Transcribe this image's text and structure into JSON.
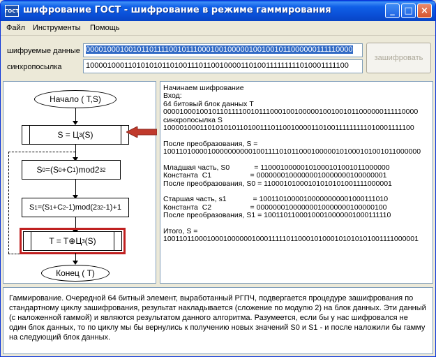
{
  "window": {
    "icon_label": "ГОСТ",
    "title": "шифрование ГОСТ - шифрование в режиме гаммирования",
    "minimize_glyph": "_",
    "maximize_glyph": "□",
    "close_glyph": "×"
  },
  "menu": {
    "items": [
      "Файл",
      "Инструменты",
      "Помощь"
    ]
  },
  "form": {
    "data_label": "шифруемые данные",
    "data_value": "0000100010010110111100101110001001000001001001011000000111110000",
    "sync_label": "синхропосылка",
    "sync_value": "1000010001101010101101001110110010000110100111111111010001111100",
    "encrypt_button": "зашифровать"
  },
  "flowchart": {
    "start": "Начало ( T,S)",
    "step1": {
      "lhs": "S = ",
      "func": "Ц",
      "sub": "3",
      "arg": "(S)"
    },
    "step2": {
      "a": "S",
      "a_sub": "0",
      "mid": "=(S",
      "mid_sub": "0",
      "plus": "+C",
      "c_sub": "1",
      "tail": ")mod2",
      "pow": "32"
    },
    "step3": {
      "a": "S",
      "a_sub": "1",
      "mid": "=(S",
      "mid_sub": "1",
      "plus": "+C",
      "c_sub": "2",
      "tail": "-1)mod(2",
      "pow": "32",
      "end": "-1)+1"
    },
    "step4": {
      "lhs": "T = T",
      "op": "⊕",
      "func": "Ц",
      "sub": "3",
      "arg": "(S)"
    },
    "end": "Конец ( T)",
    "colors": {
      "highlight": "#c02020",
      "arrow": "#c0392b"
    }
  },
  "log": {
    "lines": [
      "Начинаем шифрование",
      "Вход:",
      "64 битовый блок данных T",
      "0000100010010110111100101110001001000001001001011000000111110000",
      "синхропосылка S",
      "1000010001101010101101001110110010000110100111111111010001111100",
      "",
      "После преобразования, S =",
      "1001101000010000000000100111101011000100000101000101001011000000",
      "",
      "Младшая часть, S0            = 11000100000101000101001011000000",
      "Константа  C1                   = 00000001000000010000000100000001",
      "После преобразования, S0 = 11000101000101010101001111000001",
      "",
      "Старшая часть, s1             = 10011010000100000000001000111010",
      "Константа  C2                   = 00000001000000010000000100000100",
      "После преобразования, S1 = 10011011000100010000001000111110",
      "",
      "Итого, S =",
      "1001101100010001000000100011111011000101000101010101001111000001"
    ]
  },
  "description": {
    "text": "Гаммирование. Очередной 64 битный элемент, выработанный РГПЧ, подвергается процедуре зашифрования по стандартному циклу зашифрования, результат накладывается (сложение по модулю 2) на блок данных. Эти данный (с наложенной гаммой) и являются результатом данного алгоритма. Разумеется, если бы у нас шифровался не один блок данных, то по циклу мы бы вернулись к получению новых значений S0 и S1 - и после наложили бы гамму на следующий блок данных."
  }
}
